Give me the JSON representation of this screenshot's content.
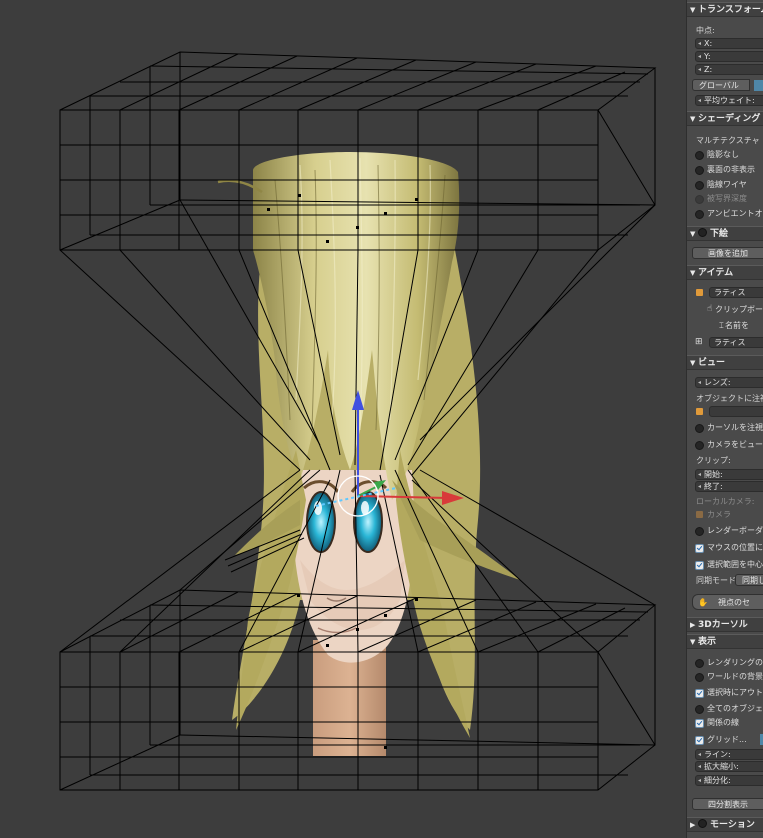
{
  "panel": {
    "transform": {
      "header": "トランスフォーム",
      "median_label": "中点:",
      "x_label": "X:",
      "y_label": "Y:",
      "z_label": "Z:",
      "orientation_label": "グローバル",
      "avg_weight_label": "平均ウェイト:"
    },
    "shading": {
      "header": "シェーディング",
      "mode_label": "マルチテクスチャ",
      "items": [
        {
          "label": "陰影なし",
          "checked": false,
          "disabled": false
        },
        {
          "label": "裏面の非表示",
          "checked": false,
          "disabled": false
        },
        {
          "label": "陰線ワイヤ",
          "checked": false,
          "disabled": false
        },
        {
          "label": "被写界深度",
          "checked": false,
          "disabled": true
        },
        {
          "label": "アンビエントオクルージョン",
          "checked": false,
          "disabled": false
        }
      ]
    },
    "background": {
      "header": "下絵",
      "add_image_label": "画像を追加"
    },
    "item": {
      "header": "アイテム",
      "object_name": "ラティス",
      "clipboard_label": "クリップボード",
      "rename_label": "名前を",
      "data_name": "ラティス"
    },
    "view": {
      "header": "ビュー",
      "lens_label": "レンズ:",
      "lock_object_label": "オブジェクトに注視",
      "lock_cursor_label": "カーソルを注視",
      "lock_camera_label": "カメラをビューに",
      "clip_label": "クリップ:",
      "clip_start_label": "開始:",
      "clip_end_label": "終了:",
      "local_camera_label": "ローカルカメラ:",
      "camera_label": "カメラ",
      "render_border_label": "レンダーボーダー",
      "zoom_mouse_label": "マウスの位置に",
      "rotate_selection_label": "選択範囲を中心",
      "sync_mode_label": "同期モード",
      "sync_mode_value": "同期し",
      "viewpoint_button": "視点のセ"
    },
    "cursor": {
      "header": "3Dカーソル"
    },
    "display": {
      "header": "表示",
      "items": [
        {
          "label": "レンダリングのみ",
          "checked": false
        },
        {
          "label": "ワールドの背景",
          "checked": false
        },
        {
          "label": "選択時にアウトライン",
          "checked": true
        },
        {
          "label": "全てのオブジェクト",
          "checked": false
        },
        {
          "label": "関係の線",
          "checked": true
        },
        {
          "label": "グリッド...",
          "checked": true
        }
      ],
      "lines_label": "ライン:",
      "scale_label": "拡大縮小:",
      "subdivisions_label": "細分化:",
      "quad_view_button": "四分割表示"
    },
    "motion": {
      "header": "モーション"
    }
  },
  "colors": {
    "viewport_bg": "#3d3d3d",
    "panel_bg": "#4a4a4a",
    "lattice": "#000000",
    "hair": "#c9c07a",
    "skin": "#ebd3c2",
    "eye": "#2aa9c9",
    "axis_x": "#d83a3a",
    "axis_z": "#4050e0",
    "axis_y": "#3aa84a",
    "accent": "#4f87a8"
  }
}
